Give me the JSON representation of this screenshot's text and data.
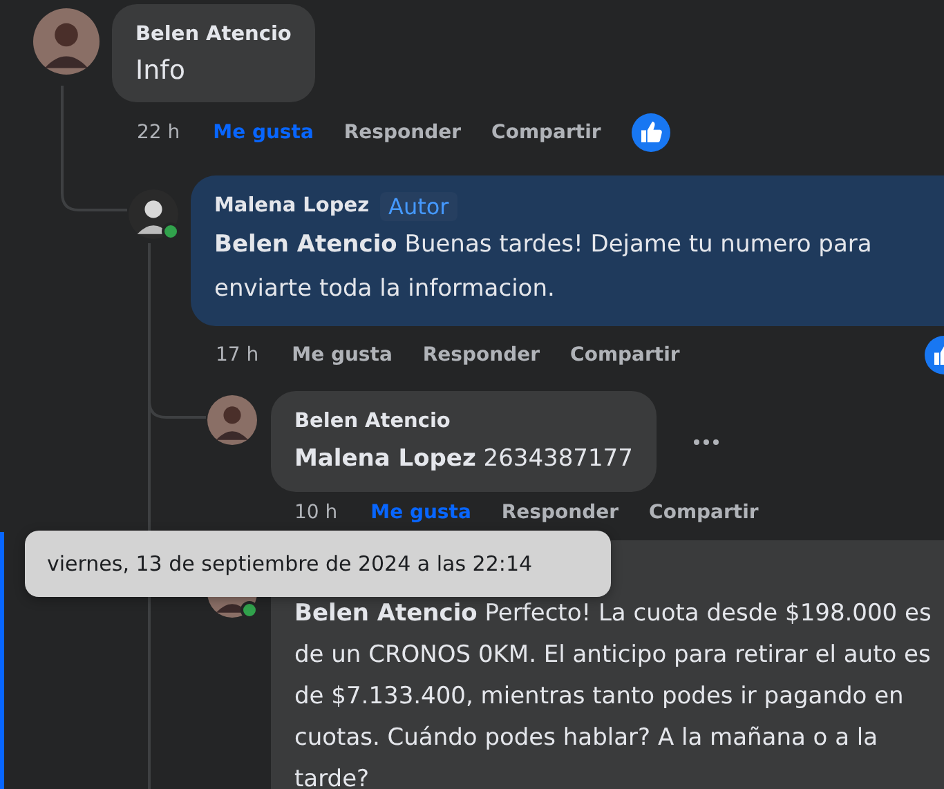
{
  "comments": [
    {
      "author": "Belen Atencio",
      "body": "Info",
      "time": "22 h",
      "liked": true,
      "reaction": true,
      "actions": [
        "Me gusta",
        "Responder",
        "Compartir"
      ],
      "children": [
        {
          "author": "Malena Lopez",
          "badge": "Autor",
          "author_reply": true,
          "body": "**Belen Atencio** Buenas tardes! Dejame tu numero para enviarte toda la informacion.",
          "time": "17 h",
          "liked": false,
          "online": true,
          "reaction": true,
          "actions": [
            "Me gusta",
            "Responder",
            "Compartir"
          ],
          "children": [
            {
              "author": "Belen Atencio",
              "body": "**Malena Lopez** 2634387177",
              "time": "10 h",
              "liked": true,
              "more": true,
              "actions": [
                "Me gusta",
                "Responder",
                "Compartir"
              ]
            },
            {
              "body": "**Belen Atencio** Perfecto! La cuota desde $198.000 es de un CRONOS 0KM. El anticipo para retirar el auto es de $7.133.400, mientras tanto podes ir pagando en cuotas. Cuándo podes hablar? A la mañana o a la tarde?",
              "online": true,
              "highlighted": true
            }
          ]
        }
      ]
    }
  ],
  "tooltip": "viernes, 13 de septiembre de 2024 a las 22:14"
}
